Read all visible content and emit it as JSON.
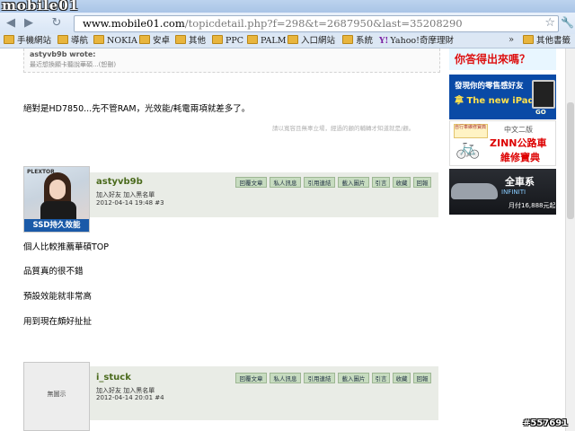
{
  "browser": {
    "watermark": "mobile01",
    "url_host": "www.mobile01.com",
    "url_path": "/topicdetail.php?f=298&t=2687950&last=35208290",
    "bookmarks": [
      "手機網站",
      "導航",
      "NOKIA",
      "安卓",
      "其他",
      "PPC",
      "PALM",
      "入口網站",
      "系統",
      "Yahoo!奇摩理財"
    ],
    "other_bookmarks": "其他書籤",
    "icons": {
      "back": "back-arrow-icon",
      "forward": "forward-arrow-icon",
      "reload": "reload-icon",
      "star": "star-icon",
      "wrench": "wrench-icon",
      "page": "page-icon",
      "folder": "folder-icon"
    }
  },
  "quote": {
    "author": "astyvb9b wrote:",
    "text": "最近想換顯卡聽說華碩...(恕刪)"
  },
  "reply_text": "絕對是HD7850...先不管RAM，光效能/耗電兩項就差多了。",
  "signature": "請以寬容且無辜立場，經過的顧的輔轉才知道就是/顧。",
  "posts": [
    {
      "username": "astyvb9b",
      "links": "加入好友  加入黑名單",
      "date": "2012-04-14 19:48  #3",
      "avatar_brand": "PLEXTOR",
      "avatar_caption": "SSD持久效能",
      "body": [
        "個人比較推薦華碩TOP",
        "品質真的很不錯",
        "預設效能就非常高",
        "用到現在頗好扯扯"
      ]
    },
    {
      "username": "i_stuck",
      "links": "加入好友  加入黑名單",
      "date": "2012-04-14 20:01  #4",
      "avatar_placeholder": "無圖示"
    }
  ],
  "actions": [
    "回覆文章",
    "私人訊息",
    "引用連結",
    "載入圖片",
    "引言",
    "收藏",
    "回報"
  ],
  "ads": {
    "a1": "你答得出來嗎？",
    "a2_line1": "發現你的零售感好友",
    "a2_line2": "拿 The new iPad",
    "a2_go": "GO",
    "a3_book": "自行車維修寶典",
    "a3_line1": "中文二版",
    "a3_line2": "ZINN公路車",
    "a3_line3": "維修寶典",
    "a4_line1": "全車系",
    "a4_line2": "INFINITI",
    "a4_line3": "月付16,888元起"
  },
  "overlay_id": "#557691"
}
